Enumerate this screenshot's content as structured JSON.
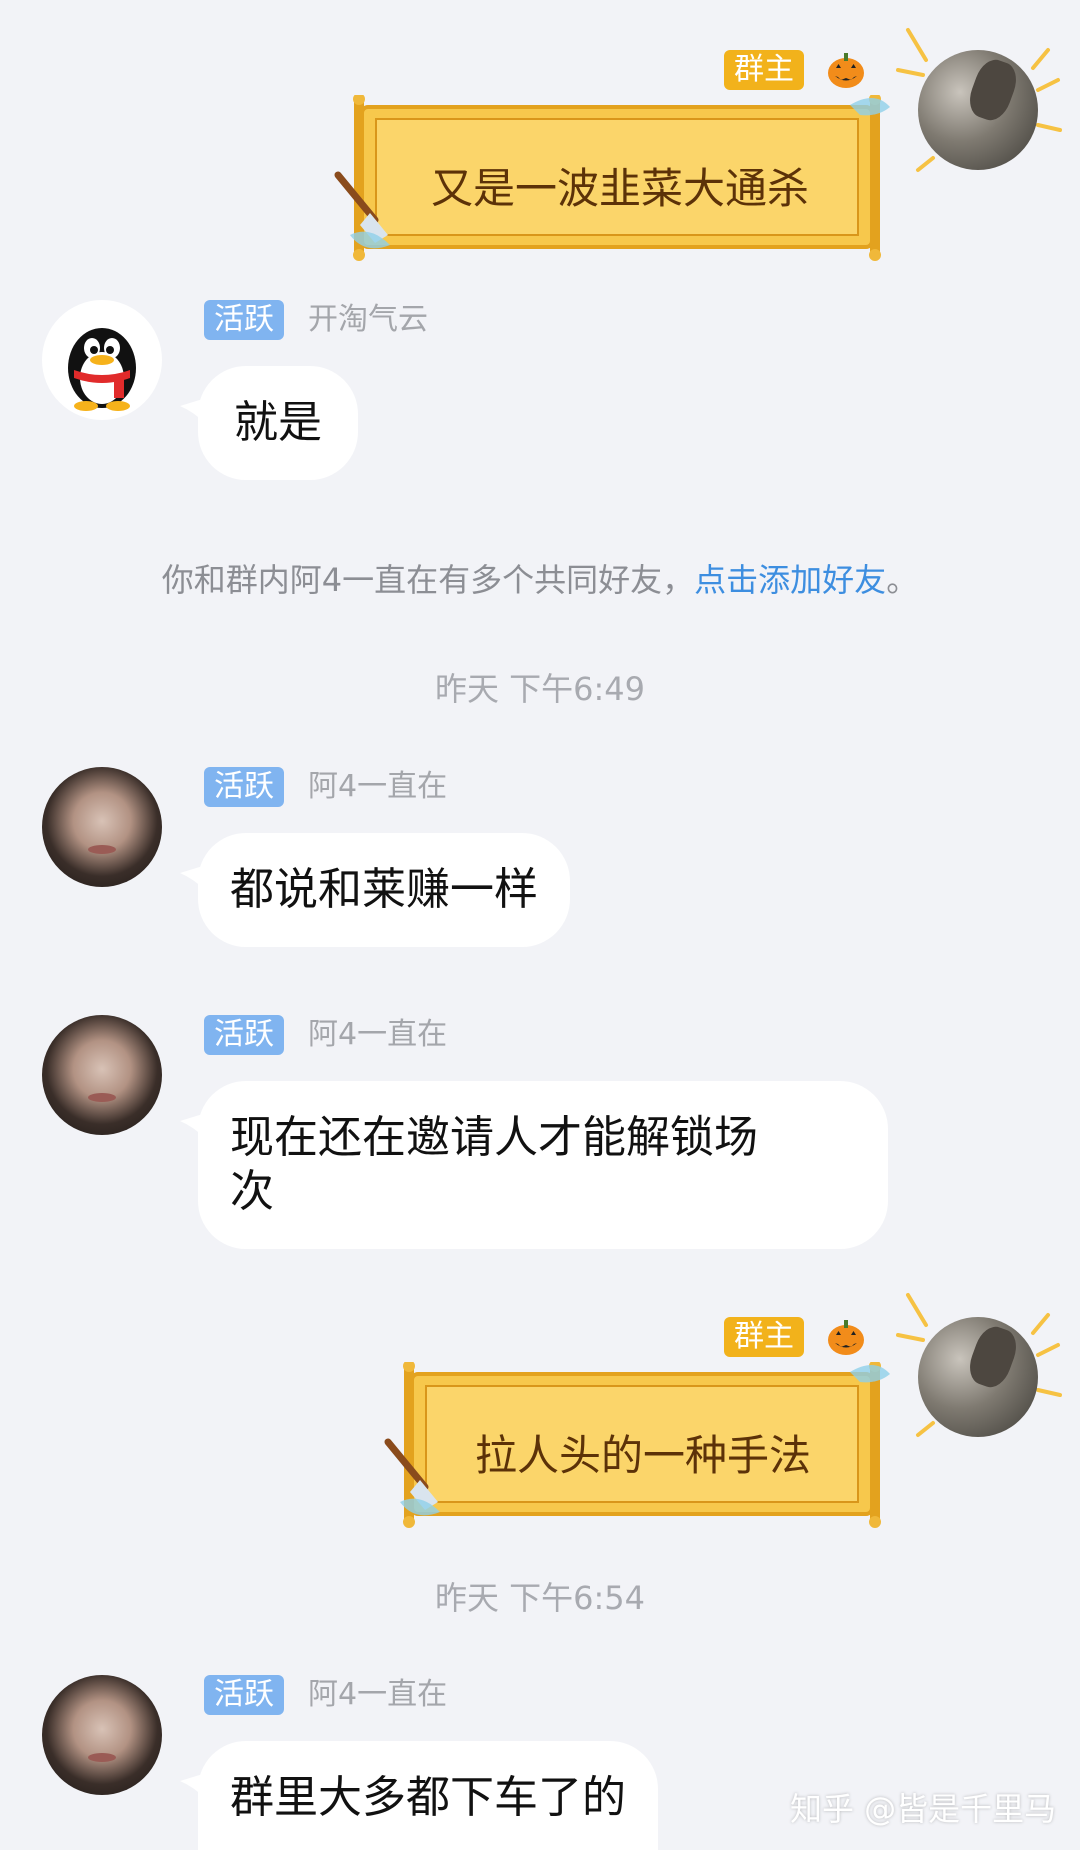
{
  "messages": {
    "m1": {
      "tag": "群主",
      "text": "又是一波韭菜大通杀"
    },
    "m2": {
      "tag": "活跃",
      "nick": "开淘气云",
      "text": "就是"
    },
    "system": {
      "text_before": "你和群内阿4一直在有多个共同好友，",
      "link": "点击添加好友",
      "text_after": "。"
    },
    "time1": "昨天 下午6:49",
    "m3": {
      "tag": "活跃",
      "nick": "阿4一直在",
      "text": "都说和莱赚一样"
    },
    "m4": {
      "tag": "活跃",
      "nick": "阿4一直在",
      "line1": "现在还在邀请人才能解锁场",
      "line2": "次"
    },
    "m5": {
      "tag": "群主",
      "text": "拉人头的一种手法"
    },
    "time2": "昨天 下午6:54",
    "m6": {
      "tag": "活跃",
      "nick": "阿4一直在",
      "text": "群里大多都下车了的"
    }
  },
  "watermark": "知乎 @皆是千里马",
  "icons": [
    "pumpkin-icon",
    "qq-penguin-icon",
    "scroll-brush-icon",
    "sparkle-icon"
  ],
  "colors": {
    "background": "#f2f3f7",
    "owner_tag": "#f2b21b",
    "active_tag": "#80b4f0",
    "link": "#3d8ee0",
    "scroll_fill": "#f7c84c"
  }
}
